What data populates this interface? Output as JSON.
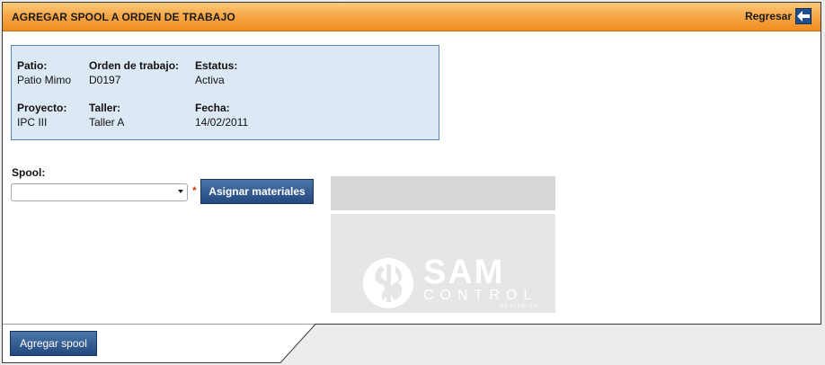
{
  "header": {
    "title": "AGREGAR SPOOL A ORDEN DE TRABAJO",
    "back_label": "Regresar",
    "back_icon": "arrow-left-icon"
  },
  "info": {
    "patio": {
      "label": "Patio:",
      "value": "Patio Mimo"
    },
    "orden": {
      "label": "Orden de trabajo:",
      "value": "D0197"
    },
    "estatus": {
      "label": "Estatus:",
      "value": "Activa"
    },
    "proyecto": {
      "label": "Proyecto:",
      "value": "IPC III"
    },
    "taller": {
      "label": "Taller:",
      "value": "Taller A"
    },
    "fecha": {
      "label": "Fecha:",
      "value": "14/02/2011"
    }
  },
  "form": {
    "spool_label": "Spool:",
    "spool_value": "",
    "required_mark": "*",
    "assign_button": "Asignar materiales"
  },
  "logo": {
    "name": "SAM",
    "sub": "CONTROL",
    "by": "BY STEELGO"
  },
  "footer": {
    "add_button": "Agregar spool"
  },
  "colors": {
    "header_orange": "#f08c1e",
    "info_bg": "#dde8f5",
    "button_blue": "#23497e",
    "required_red": "#d03a16"
  }
}
